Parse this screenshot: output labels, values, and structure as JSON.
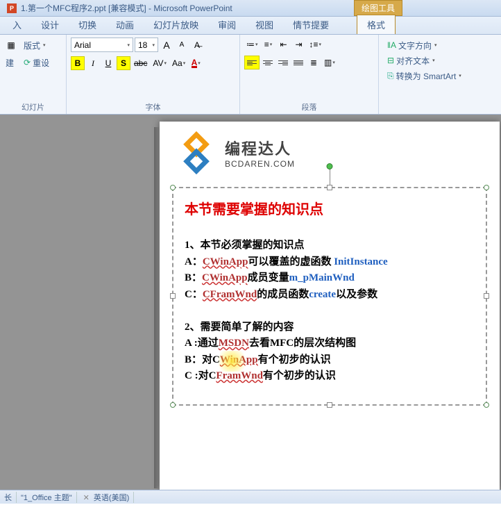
{
  "titlebar": {
    "pp_icon_text": "P",
    "filename": "1.第一个MFC程序2.ppt [兼容模式] - Microsoft PowerPoint",
    "tool_context": "绘图工具"
  },
  "tabs": {
    "insert_cut": "入",
    "design": "设计",
    "transition": "切换",
    "animation": "动画",
    "slideshow": "幻灯片放映",
    "review": "审阅",
    "view": "视图",
    "story": "情节提要",
    "format": "格式"
  },
  "ribbon": {
    "clipboard": {
      "layout": "版式",
      "build": "建",
      "reset": "重设",
      "group": "幻灯片"
    },
    "font": {
      "name": "Arial",
      "size": "18",
      "grow": "A",
      "shrink": "A",
      "clear": "Aa",
      "bold": "B",
      "italic": "I",
      "underline": "U",
      "shadow": "S",
      "strike": "abc",
      "spacing": "AV",
      "case": "Aa",
      "color": "A",
      "group": "字体"
    },
    "para": {
      "text_dir": "文字方向",
      "align_text": "对齐文本",
      "smartart": "转换为 SmartArt",
      "group": "段落"
    }
  },
  "nav": {
    "slides_tab": "幻灯片"
  },
  "slide": {
    "logo_cn": "编程达人",
    "logo_en": "BCDAREN.COM",
    "title": "本节需要掌握的知识点",
    "line1_num": "1、",
    "line1_text": "本节必须掌握的知识点",
    "lA_label": "A：",
    "lA_cls": "CWinApp",
    "lA_mid": "可以覆盖的虚函数 ",
    "lA_fn": "InitInstance",
    "lB_label": "B：",
    "lB_cls": "CWinApp",
    "lB_mid": "成员变量",
    "lB_var": "m_pMainWnd",
    "lC_label": "C：",
    "lC_cls": "CFramWnd",
    "lC_mid": "的成员函数",
    "lC_fn": "create",
    "lC_end": "以及参数",
    "line2_num": "2、",
    "line2_text": "需要简单了解的内容",
    "l2A_label": "A :",
    "l2A_pre": "通过",
    "l2A_msdn": "MSDN",
    "l2A_post": "去看MFC的层次结构图",
    "l2B_label": "B：",
    "l2B_pre": "对C",
    "l2B_cls": "WinApp",
    "l2B_post": "有个初步的认识",
    "l2C_label": "C :",
    "l2C_pre": "对C",
    "l2C_cls": "FramWnd",
    "l2C_post": "有个初步的认识"
  },
  "status": {
    "section_partial": "\"1_Office 主题\"",
    "lang": "英语(美国)",
    "left": "长"
  }
}
